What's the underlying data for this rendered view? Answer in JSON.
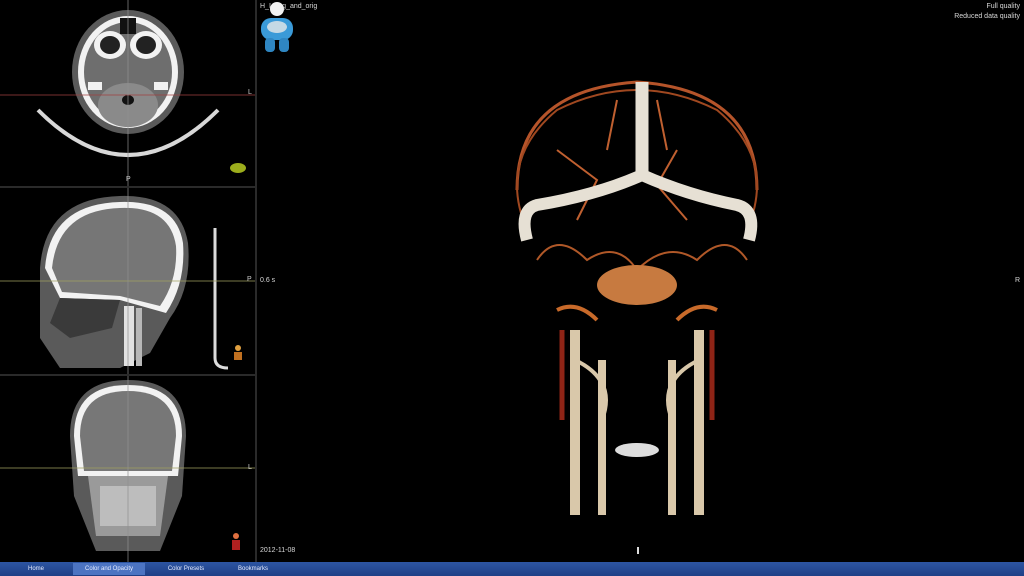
{
  "viewer": {
    "dataset_title": "H_I_seg_and_orig",
    "quality_full": "Full quality",
    "quality_reduced": "Reduced data quality",
    "scale_label": "0.6 s",
    "right_marker": "R",
    "date_label": "2012-11-08"
  },
  "panes": {
    "axial": {
      "right_label": "L",
      "bottom_label": "P"
    },
    "sagittal": {
      "right_label": "P"
    },
    "coronal": {
      "right_label": "L"
    }
  },
  "tabs": [
    {
      "label": "Home"
    },
    {
      "label": "Color and Opacity"
    },
    {
      "label": "Color Presets"
    },
    {
      "label": "Bookmarks"
    }
  ],
  "active_tab": "Color and Opacity",
  "colors": {
    "tab_bar": "#2a4f9a",
    "tab_active": "#4c74c2",
    "crosshair_h": "#a04040",
    "crosshair_v": "#909090",
    "vessel_bone": "#e8e0d0",
    "vessel_red": "#b5542a"
  },
  "icons": {
    "orientation_axial": "orientation-cube-icon",
    "orientation_sagittal": "person-orientation-icon",
    "orientation_coronal": "person-orientation-icon",
    "main_orientation": "patient-orientation-avatar-icon"
  }
}
